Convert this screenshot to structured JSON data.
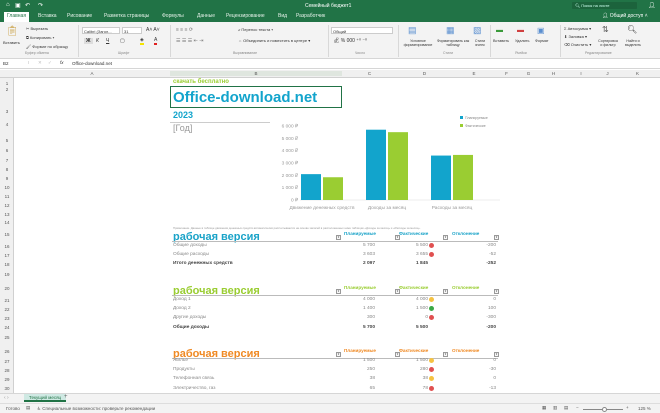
{
  "title": "Семейный бюджет1",
  "search_placeholder": "Поиск на листе",
  "share": "Общий доступ",
  "tabs": [
    "Главная",
    "Вставка",
    "Рисование",
    "Разметка страницы",
    "Формулы",
    "Данные",
    "Рецензирование",
    "Вид",
    "Разработчик"
  ],
  "ribbon": {
    "paste": "Вставить",
    "cut": "Вырезать",
    "copy": "Копировать",
    "format_painter": "Формат по образцу",
    "clipboard": "Буфер обмена",
    "font_name": "Calibri (Загол...",
    "font_size": "31",
    "font": "Шрифт",
    "wrap": "Перенос текста",
    "merge": "Объединить и поместить в центре",
    "alignment": "Выравнивание",
    "number_format": "Общий",
    "number": "Число",
    "cond_format": "Условное форматирование",
    "format_table": "Форматировать как таблицу",
    "cell_styles": "Стили ячеек",
    "styles": "Стили",
    "insert": "Вставить",
    "delete": "Удалить",
    "format": "Формат",
    "cells": "Ячейки",
    "autosum": "Автосумма",
    "fill": "Заливка",
    "clear": "Очистить",
    "sort": "Сортировка и фильтр",
    "find": "Найти и выделить",
    "editing": "Редактирование"
  },
  "formula_bar": {
    "cell_ref": "B2",
    "formula": "Office-download.net"
  },
  "columns": [
    "A",
    "B",
    "C",
    "D",
    "E",
    "F",
    "G",
    "H",
    "I",
    "J",
    "K"
  ],
  "rows": [
    "1",
    "2",
    "3",
    "4",
    "5",
    "6",
    "7",
    "8",
    "9",
    "10",
    "11",
    "12",
    "13",
    "14",
    "15",
    "16",
    "17",
    "18",
    "19",
    "20",
    "21",
    "22",
    "23",
    "24",
    "25",
    "26",
    "27",
    "28",
    "29",
    "30"
  ],
  "sheet": {
    "download_free": "скачать бесплатно",
    "site": "Office-download.net",
    "year": "2023",
    "year_placeholder": "[Год]",
    "note": "Примечание. Данные в таблице движения денежных средств автоматически рассчитываются на основе записей в расположенных ниже таблицах «Доходы за месяц» и «Расходы за месяц».",
    "tables": [
      {
        "title": "рабочая версия",
        "color": "#1aa3c8",
        "headers": [
          "Планируемые",
          "Фактические",
          "Отклонение"
        ],
        "rows": [
          {
            "label": "Общие доходы",
            "plan": "5 700",
            "fact": "5 500",
            "status": "red",
            "diff": "-200",
            "bold": false
          },
          {
            "label": "Общие расходы",
            "plan": "3 603",
            "fact": "3 655",
            "status": "red",
            "diff": "-52",
            "bold": false
          },
          {
            "label": "Итого денежных средств",
            "plan": "2 097",
            "fact": "1 845",
            "status": "",
            "diff": "-252",
            "bold": true
          }
        ]
      },
      {
        "title": "рабочая версия",
        "color": "#9acd32",
        "headers": [
          "Планируемые",
          "Фактические",
          "Отклонение"
        ],
        "rows": [
          {
            "label": "Доход 1",
            "plan": "4 000",
            "fact": "4 000",
            "status": "yellow",
            "diff": "0",
            "bold": false
          },
          {
            "label": "Доход 2",
            "plan": "1 400",
            "fact": "1 500",
            "status": "green",
            "diff": "100",
            "bold": false
          },
          {
            "label": "Другие доходы",
            "plan": "300",
            "fact": "0",
            "status": "red",
            "diff": "-300",
            "bold": false
          },
          {
            "label": "Общие доходы",
            "plan": "5 700",
            "fact": "5 500",
            "status": "",
            "diff": "-200",
            "bold": true
          }
        ]
      },
      {
        "title": "рабочая версия",
        "color": "#f08a24",
        "headers": [
          "Планируемые",
          "Фактические",
          "Отклонение"
        ],
        "rows": [
          {
            "label": "Жилье",
            "plan": "1 500",
            "fact": "1 500",
            "status": "yellow",
            "diff": "0",
            "bold": false
          },
          {
            "label": "Продукты",
            "plan": "250",
            "fact": "280",
            "status": "red",
            "diff": "-30",
            "bold": false
          },
          {
            "label": "Телефонная связь",
            "plan": "38",
            "fact": "38",
            "status": "yellow",
            "diff": "0",
            "bold": false
          },
          {
            "label": "Электричество, газ",
            "plan": "65",
            "fact": "78",
            "status": "red",
            "diff": "-13",
            "bold": false
          }
        ]
      }
    ]
  },
  "chart_data": {
    "type": "bar",
    "categories": [
      "Движение денежных средств",
      "Доходы за месяц",
      "Расходы за месяц"
    ],
    "series": [
      {
        "name": "Планируемые",
        "color": "#12a4cc",
        "values": [
          2097,
          5700,
          3603
        ]
      },
      {
        "name": "Фактические",
        "color": "#9acd32",
        "values": [
          1845,
          5500,
          3655
        ]
      }
    ],
    "ylim": [
      0,
      6000
    ],
    "yticks": [
      "0 ₽",
      "1 000 ₽",
      "2 000 ₽",
      "3 000 ₽",
      "4 000 ₽",
      "5 000 ₽",
      "6 000 ₽"
    ],
    "legend": "top-right",
    "grid": false
  },
  "sheet_tab": "Текущий месяц",
  "status": {
    "ready": "Готово",
    "accessibility": "Специальные возможности: проверьте рекомендации",
    "zoom": "125 %"
  }
}
